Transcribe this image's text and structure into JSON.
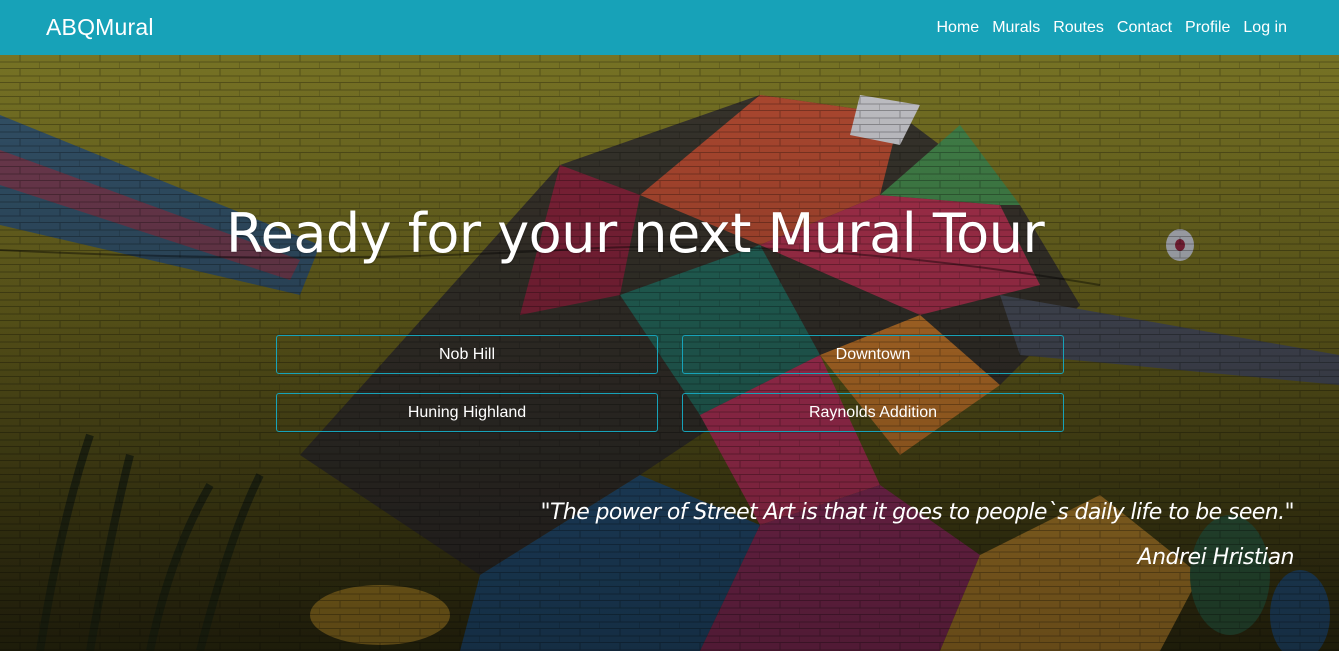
{
  "navbar": {
    "brand": "ABQMural",
    "color": "#17a2b8",
    "links": [
      {
        "label": "Home"
      },
      {
        "label": "Murals"
      },
      {
        "label": "Routes"
      },
      {
        "label": "Contact"
      },
      {
        "label": "Profile"
      },
      {
        "label": "Log in"
      }
    ]
  },
  "hero": {
    "background": "mural-photo",
    "headline": "Ready for your next Mural Tour",
    "routes": [
      {
        "label": "Nob Hill"
      },
      {
        "label": "Downtown"
      },
      {
        "label": "Huning Highland"
      },
      {
        "label": "Raynolds Addition"
      }
    ],
    "quote": "\"The power of Street Art is that it goes to people`s daily life to be seen.\"",
    "author": "Andrei Hristian"
  }
}
